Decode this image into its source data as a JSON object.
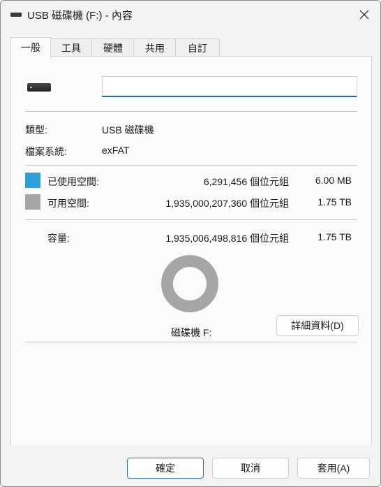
{
  "window": {
    "title": "USB 磁碟機 (F:) - 內容"
  },
  "tabs": [
    {
      "label": "一般"
    },
    {
      "label": "工具"
    },
    {
      "label": "硬體"
    },
    {
      "label": "共用"
    },
    {
      "label": "自訂"
    }
  ],
  "general": {
    "name_value": "",
    "type_label": "類型:",
    "type_value": "USB 磁碟機",
    "fs_label": "檔案系統:",
    "fs_value": "exFAT",
    "used_label": "已使用空間:",
    "used_bytes": "6,291,456 個位元組",
    "used_size": "6.00 MB",
    "free_label": "可用空間:",
    "free_bytes": "1,935,000,207,360 個位元組",
    "free_size": "1.75 TB",
    "cap_label": "容量:",
    "cap_bytes": "1,935,006,498,816 個位元組",
    "cap_size": "1.75 TB",
    "drive_label": "磁碟機 F:",
    "details_button": "詳細資料(D)",
    "used_fraction": 3.3e-06
  },
  "colors": {
    "used": "#2c9fd8",
    "free": "#a6a6a6"
  },
  "footer": {
    "ok": "確定",
    "cancel": "取消",
    "apply": "套用(A)"
  }
}
